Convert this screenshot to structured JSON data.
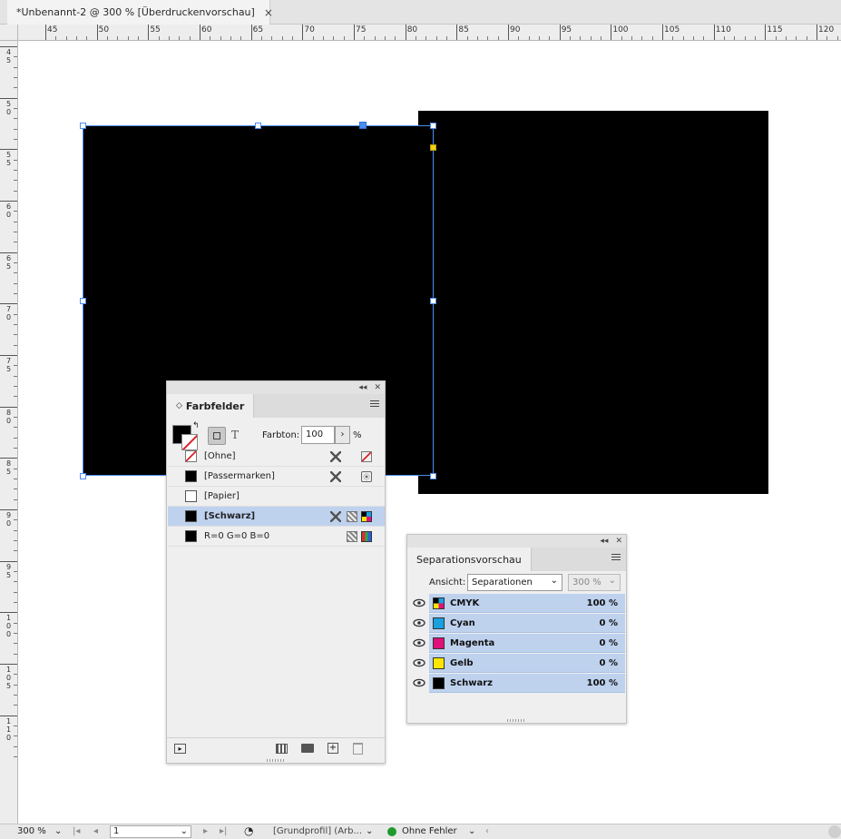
{
  "tab": {
    "title": "*Unbenannt-2 @ 300 % [Überdruckenvorschau]",
    "close_glyph": "×"
  },
  "ruler_top": {
    "labels": [
      "45",
      "50",
      "55",
      "60",
      "65",
      "70",
      "75",
      "80",
      "85",
      "90",
      "95",
      "100",
      "105",
      "110",
      "115",
      "120"
    ]
  },
  "ruler_left": {
    "labels": [
      "45",
      "50",
      "55",
      "60",
      "65",
      "70",
      "75",
      "80",
      "85",
      "90",
      "95",
      "100",
      "105",
      "110"
    ]
  },
  "swatches_panel": {
    "title": "Farbfelder",
    "tint_label": "Farbton:",
    "tint_value": "100",
    "tint_unit": "%",
    "text_mode_glyph": "T",
    "items": [
      {
        "name": "[Ohne]",
        "chip": "none",
        "icons": [
          "no-edit-icon",
          "none-swatch-icon"
        ]
      },
      {
        "name": "[Passermarken]",
        "chip": "#000000",
        "icons": [
          "no-edit-icon",
          "registration-icon"
        ]
      },
      {
        "name": "[Papier]",
        "chip": "#ffffff",
        "icons": []
      },
      {
        "name": "[Schwarz]",
        "chip": "#000000",
        "selected": true,
        "icons": [
          "no-edit-icon",
          "process-icon",
          "cmyk-icon"
        ]
      },
      {
        "name": "R=0 G=0 B=0",
        "chip": "#000000",
        "icons": [
          "process-icon",
          "rgb-icon"
        ]
      }
    ]
  },
  "separations_panel": {
    "title": "Separationsvorschau",
    "view_label": "Ansicht:",
    "view_value": "Separationen",
    "zoom_value": "300 %",
    "rows": [
      {
        "name": "CMYK",
        "value": "100 %",
        "color": "cmyk"
      },
      {
        "name": "Cyan",
        "value": "0 %",
        "color": "#1aa0e0"
      },
      {
        "name": "Magenta",
        "value": "0 %",
        "color": "#e0107a"
      },
      {
        "name": "Gelb",
        "value": "0 %",
        "color": "#ffe600"
      },
      {
        "name": "Schwarz",
        "value": "100 %",
        "color": "#000000"
      }
    ]
  },
  "status_bar": {
    "zoom": "300 %",
    "page": "1",
    "profile": "[Grundprofil] (Arb...",
    "preflight": "Ohne Fehler",
    "preflight_color": "#1f9a2e"
  }
}
